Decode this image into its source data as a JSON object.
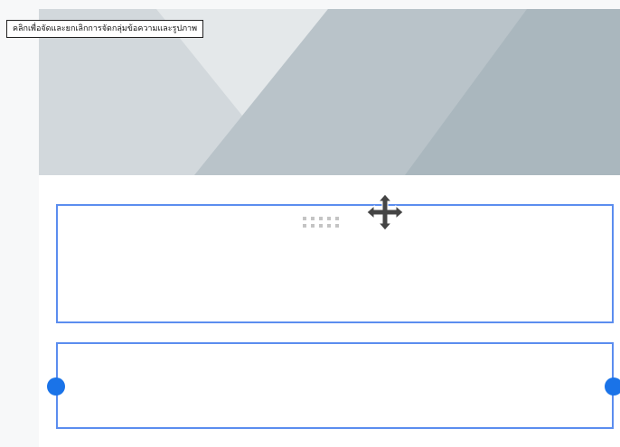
{
  "tooltip": {
    "text": "คลิกเพื่อจัดและยกเลิกการจัดกลุ่มข้อความและรูปภาพ"
  },
  "colors": {
    "selection_border": "#5b8def",
    "handle": "#1a73e8",
    "banner_light": "#d2d8dc",
    "banner_mid": "#b9c3c9",
    "banner_dark": "#a9b7be"
  },
  "icons": {
    "drag_grip": "drag-grip-icon",
    "move_cursor": "move-cursor-icon",
    "left_resize_handle": "resize-handle-icon",
    "right_resize_handle": "resize-handle-icon"
  }
}
